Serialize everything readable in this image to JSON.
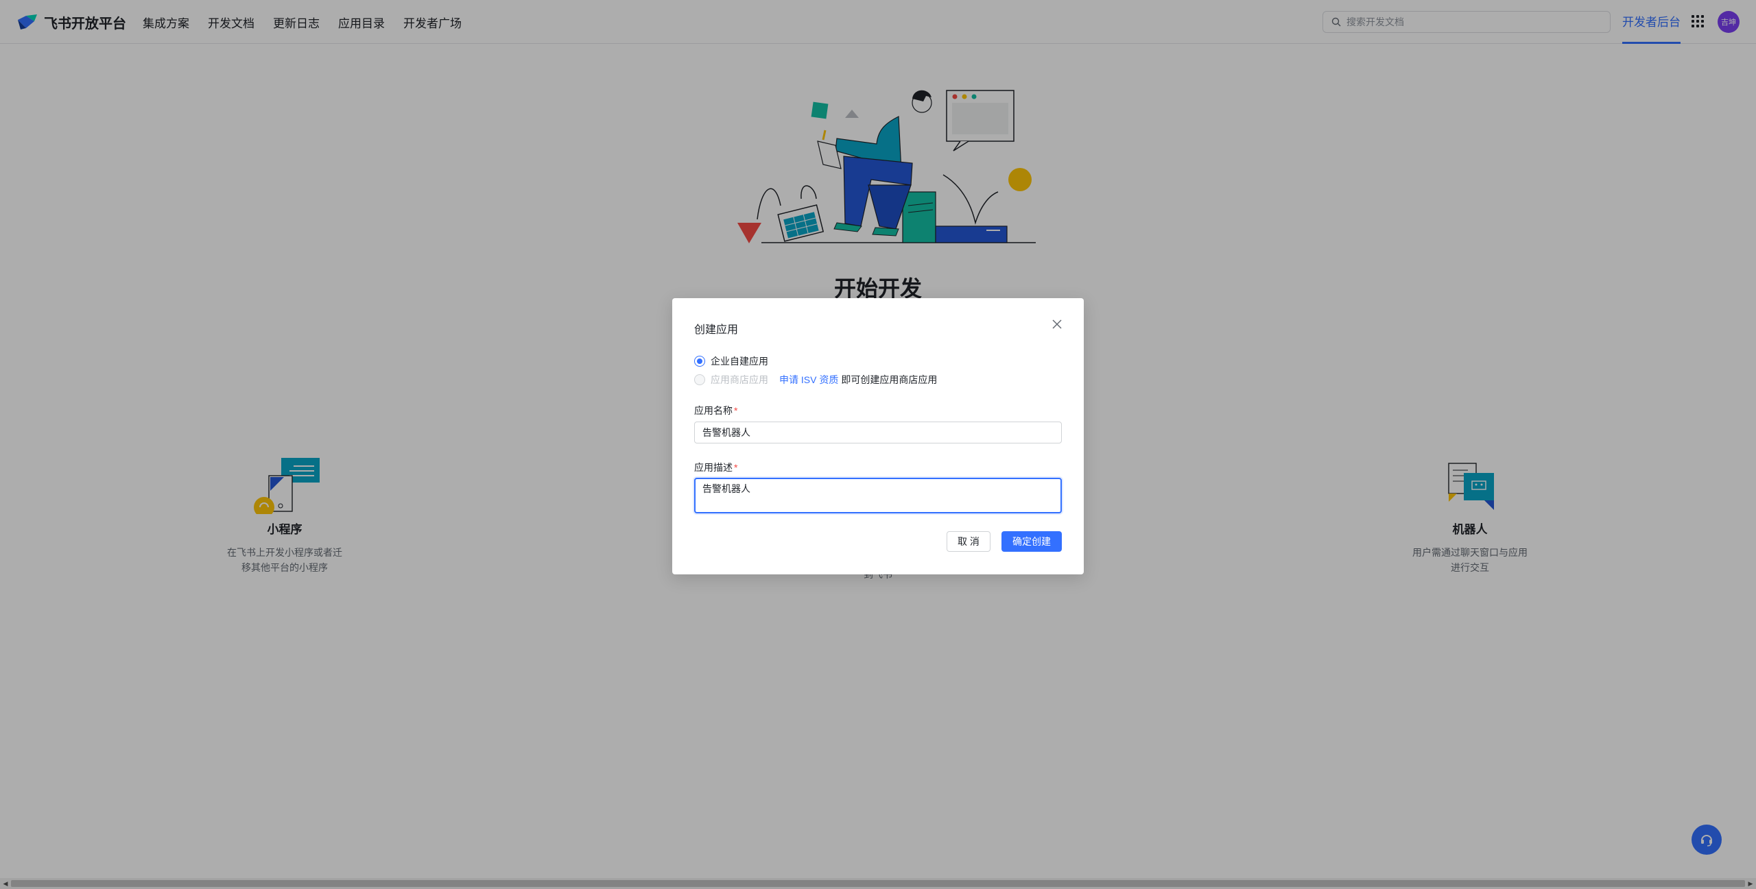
{
  "header": {
    "logo_text": "飞书开放平台",
    "nav": [
      "集成方案",
      "开发文档",
      "更新日志",
      "应用目录",
      "开发者广场"
    ],
    "search_placeholder": "搜索开发文档",
    "dev_console": "开发者后台",
    "avatar_text": "吉坤"
  },
  "main": {
    "title": "开始开发",
    "cards": [
      {
        "title": "小程序",
        "desc_line1": "在飞书上开发小程序或者迁",
        "desc_line2": "移其他平台的小程序"
      },
      {
        "title": "机器人",
        "desc_line1": "用户需通过聊天窗口与应用",
        "desc_line2": "进行交互"
      }
    ],
    "center_partial_text": "到飞书"
  },
  "modal": {
    "title": "创建应用",
    "radio_enterprise": "企业自建应用",
    "radio_store": "应用商店应用",
    "apply_link": "申请 ISV 资质",
    "apply_suffix": "即可创建应用商店应用",
    "name_label": "应用名称",
    "name_value": "告警机器人",
    "desc_label": "应用描述",
    "desc_value": "告警机器人",
    "required_mark": "*",
    "cancel": "取 消",
    "confirm": "确定创建"
  },
  "colors": {
    "accent": "#3370ff",
    "avatar": "#7b3ff2",
    "required": "#f54a45"
  }
}
